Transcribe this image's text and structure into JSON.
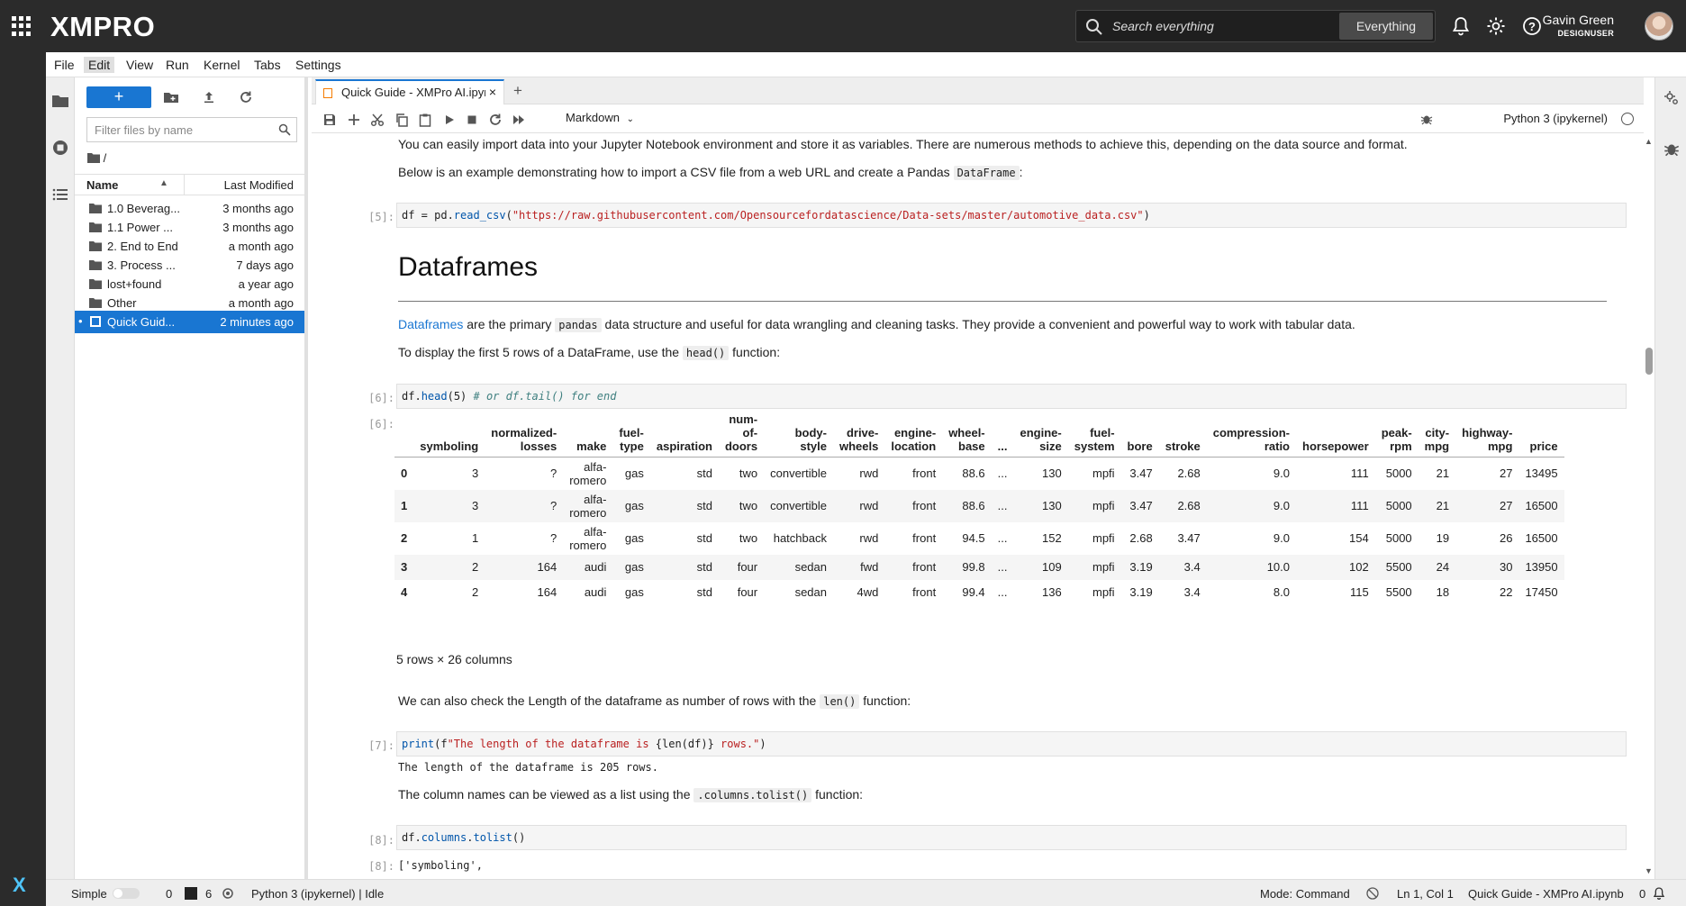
{
  "topbar": {
    "logo": "XMPRO",
    "search_placeholder": "Search everything",
    "search_scope": "Everything",
    "user_name": "Gavin Green",
    "user_role": "DESIGNUSER"
  },
  "menu": [
    "File",
    "Edit",
    "View",
    "Run",
    "Kernel",
    "Tabs",
    "Settings"
  ],
  "filebrowser": {
    "new_label": "+",
    "filter_placeholder": "Filter files by name",
    "breadcrumb": "/",
    "col_name": "Name",
    "col_modified": "Last Modified",
    "files": [
      {
        "name": "1.0 Beverag...",
        "modified": "3 months ago",
        "type": "folder"
      },
      {
        "name": "1.1 Power ...",
        "modified": "3 months ago",
        "type": "folder"
      },
      {
        "name": "2. End to End",
        "modified": "a month ago",
        "type": "folder"
      },
      {
        "name": "3. Process ...",
        "modified": "7 days ago",
        "type": "folder"
      },
      {
        "name": "lost+found",
        "modified": "a year ago",
        "type": "folder"
      },
      {
        "name": "Other",
        "modified": "a month ago",
        "type": "folder"
      },
      {
        "name": "Quick Guid...",
        "modified": "2 minutes ago",
        "type": "notebook"
      }
    ]
  },
  "tab": {
    "label": "Quick Guide - XMPro AI.ipynb",
    "close": "×",
    "add": "+"
  },
  "toolbar": {
    "cell_type": "Markdown",
    "kernel": "Python 3 (ipykernel)"
  },
  "notebook": {
    "p1": "You can easily import data into your Jupyter Notebook environment and store it as variables. There are numerous methods to achieve this, depending on the data source and format.",
    "p2_pre": "Below is an example demonstrating how to import a CSV file from a web URL and create a Pandas ",
    "p2_code": "DataFrame",
    "p2_post": ":",
    "prompt5": "[5]:",
    "cell5_a": "df = pd.",
    "cell5_fn": "read_csv",
    "cell5_b": "(",
    "cell5_str": "\"https://raw.githubusercontent.com/Opensourcefordatascience/Data-sets/master/automotive_data.csv\"",
    "cell5_c": ")",
    "h1": "Dataframes",
    "p3_link": "Dataframes",
    "p3_a": " are the primary ",
    "p3_code": "pandas",
    "p3_b": " data structure and useful for data wrangling and cleaning tasks. They provide a convenient and powerful way to work with tabular data.",
    "p4_pre": "To display the first 5 rows of a DataFrame, use the ",
    "p4_code": "head()",
    "p4_post": " function:",
    "prompt6": "[6]:",
    "cell6_a": "df.",
    "cell6_fn": "head",
    "cell6_b": "(5) ",
    "cell6_cmt": "# or df.tail() for end",
    "out6": "[6]:",
    "shape": "5 rows × 26 columns",
    "p5_pre": "We can also check the Length of the dataframe as number of rows with the ",
    "p5_code": "len()",
    "p5_post": " function:",
    "prompt7": "[7]:",
    "cell7_fn": "print",
    "cell7_a": "(f",
    "cell7_str1": "\"The length of the dataframe is ",
    "cell7_b": "{len(df)}",
    "cell7_str2": " rows.\"",
    "cell7_c": ")",
    "out7": "The length of the dataframe is 205 rows.",
    "p6_pre": "The column names can be viewed as a list using the ",
    "p6_code": ".columns.tolist()",
    "p6_post": " function:",
    "prompt8": "[8]:",
    "cell8_a": "df.",
    "cell8_fn": "columns",
    "cell8_b": ".",
    "cell8_fn2": "tolist",
    "cell8_c": "()",
    "out8_prompt": "[8]:",
    "out8": "['symboling',"
  },
  "dataframe": {
    "headers": [
      "",
      "symboling",
      "normalized-\nlosses",
      "make",
      "fuel-\ntype",
      "aspiration",
      "num-\nof-\ndoors",
      "body-\nstyle",
      "drive-\nwheels",
      "engine-\nlocation",
      "wheel-\nbase",
      "...",
      "engine-\nsize",
      "fuel-\nsystem",
      "bore",
      "stroke",
      "compression-\nratio",
      "horsepower",
      "peak-\nrpm",
      "city-\nmpg",
      "highway-\nmpg",
      "price"
    ],
    "rows": [
      [
        "0",
        "3",
        "?",
        "alfa-\nromero",
        "gas",
        "std",
        "two",
        "convertible",
        "rwd",
        "front",
        "88.6",
        "...",
        "130",
        "mpfi",
        "3.47",
        "2.68",
        "9.0",
        "111",
        "5000",
        "21",
        "27",
        "13495"
      ],
      [
        "1",
        "3",
        "?",
        "alfa-\nromero",
        "gas",
        "std",
        "two",
        "convertible",
        "rwd",
        "front",
        "88.6",
        "...",
        "130",
        "mpfi",
        "3.47",
        "2.68",
        "9.0",
        "111",
        "5000",
        "21",
        "27",
        "16500"
      ],
      [
        "2",
        "1",
        "?",
        "alfa-\nromero",
        "gas",
        "std",
        "two",
        "hatchback",
        "rwd",
        "front",
        "94.5",
        "...",
        "152",
        "mpfi",
        "2.68",
        "3.47",
        "9.0",
        "154",
        "5000",
        "19",
        "26",
        "16500"
      ],
      [
        "3",
        "2",
        "164",
        "audi",
        "gas",
        "std",
        "four",
        "sedan",
        "fwd",
        "front",
        "99.8",
        "...",
        "109",
        "mpfi",
        "3.19",
        "3.4",
        "10.0",
        "102",
        "5500",
        "24",
        "30",
        "13950"
      ],
      [
        "4",
        "2",
        "164",
        "audi",
        "gas",
        "std",
        "four",
        "sedan",
        "4wd",
        "front",
        "99.4",
        "...",
        "136",
        "mpfi",
        "3.19",
        "3.4",
        "8.0",
        "115",
        "5500",
        "18",
        "22",
        "17450"
      ]
    ]
  },
  "statusbar": {
    "mode_label": "Simple",
    "terminals": "0",
    "kernels": "6",
    "kernel_status": "Python 3 (ipykernel) | Idle",
    "mode": "Mode: Command",
    "position": "Ln 1, Col 1",
    "file": "Quick Guide - XMPro AI.ipynb",
    "notifications": "0"
  },
  "colors": {
    "topbar": "#2b2b2b",
    "accent": "#1976d2",
    "x_logo": "#4fc3f7"
  }
}
